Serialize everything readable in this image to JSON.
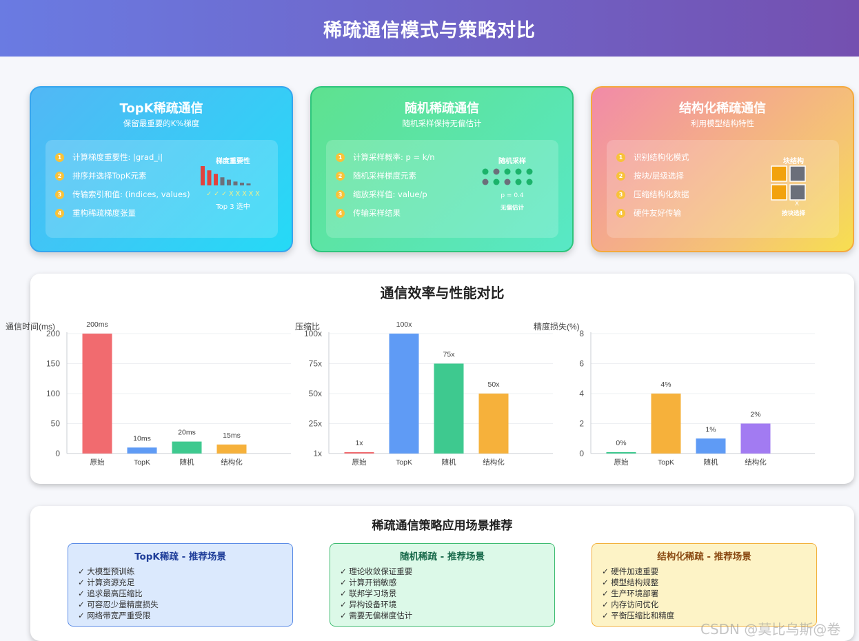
{
  "header": {
    "title": "稀疏通信模式与策略对比"
  },
  "cards": [
    {
      "title": "TopK稀疏通信",
      "subtitle": "保留最重要的K%梯度",
      "steps": [
        {
          "num": "1",
          "text": "计算梯度重要性: |grad_i|"
        },
        {
          "num": "2",
          "text": "排序并选择TopK元素"
        },
        {
          "num": "3",
          "text": "传输索引和值: (indices, values)"
        },
        {
          "num": "4",
          "text": "重构稀疏梯度张量"
        }
      ],
      "viz": {
        "title": "梯度重要性",
        "marks": "✓ ✓ ✓ X X X X X",
        "caption": "Top 3 选中",
        "bar_levels": [
          1.0,
          0.78,
          0.6,
          0.42,
          0.3,
          0.2,
          0.14,
          0.1
        ],
        "selected_color": "#e0423e",
        "other_color": "#6b6f7a"
      }
    },
    {
      "title": "随机稀疏通信",
      "subtitle": "随机采样保持无偏估计",
      "steps": [
        {
          "num": "1",
          "text": "计算采样概率: p = k/n"
        },
        {
          "num": "2",
          "text": "随机采样梯度元素"
        },
        {
          "num": "3",
          "text": "缩放采样值: value/p"
        },
        {
          "num": "4",
          "text": "传输采样结果"
        }
      ],
      "viz": {
        "title": "随机采样",
        "p_label": "p = 0.4",
        "caption": "无偏估计",
        "dot_sampled": [
          [
            true,
            false,
            true,
            true,
            true
          ],
          [
            false,
            true,
            false,
            true,
            true
          ]
        ],
        "sampled_color": "#1bb36a",
        "other_color": "#6b6f7a"
      }
    },
    {
      "title": "结构化稀疏通信",
      "subtitle": "利用模型结构特性",
      "steps": [
        {
          "num": "1",
          "text": "识别结构化模式"
        },
        {
          "num": "2",
          "text": "按块/层级选择"
        },
        {
          "num": "3",
          "text": "压缩结构化数据"
        },
        {
          "num": "4",
          "text": "硬件友好传输"
        }
      ],
      "viz": {
        "title": "块结构",
        "mark": "X",
        "caption": "按块选择",
        "block_colors": [
          "#f2a20d",
          "#6b6f7a",
          "#f2a20d",
          "#6b6f7a"
        ]
      }
    }
  ],
  "performance": {
    "title": "通信效率与性能对比"
  },
  "chart_data": [
    {
      "type": "bar",
      "ylabel": "通信时间(ms)",
      "categories": [
        "原始",
        "TopK",
        "随机",
        "结构化"
      ],
      "values": [
        200,
        10,
        20,
        15
      ],
      "data_labels": [
        "200ms",
        "10ms",
        "20ms",
        "15ms"
      ],
      "yticks": [
        "0",
        "50",
        "100",
        "150",
        "200"
      ],
      "ylim": [
        0,
        200
      ],
      "colors": [
        "#f16b6f",
        "#5f9bf5",
        "#3ec98f",
        "#f6b13b"
      ]
    },
    {
      "type": "bar",
      "ylabel": "压缩比",
      "categories": [
        "原始",
        "TopK",
        "随机",
        "结构化"
      ],
      "values": [
        1,
        100,
        75,
        50
      ],
      "data_labels": [
        "1x",
        "100x",
        "75x",
        "50x"
      ],
      "yticks": [
        "1x",
        "25x",
        "50x",
        "75x",
        "100x"
      ],
      "ylim": [
        0,
        100
      ],
      "colors": [
        "#f16b6f",
        "#5f9bf5",
        "#3ec98f",
        "#f6b13b"
      ]
    },
    {
      "type": "bar",
      "ylabel": "精度损失(%)",
      "categories": [
        "原始",
        "TopK",
        "随机",
        "结构化"
      ],
      "values": [
        0,
        4,
        1,
        2
      ],
      "data_labels": [
        "0%",
        "4%",
        "1%",
        "2%"
      ],
      "yticks": [
        "0",
        "2",
        "4",
        "6",
        "8"
      ],
      "ylim": [
        0,
        8
      ],
      "colors": [
        "#3ec98f",
        "#f6b13b",
        "#5f9bf5",
        "#a27bf2"
      ]
    }
  ],
  "recommend": {
    "title": "稀疏通信策略应用场景推荐",
    "boxes": [
      {
        "title": "TopK稀疏 - 推荐场景",
        "items": [
          "✓ 大模型预训练",
          "✓ 计算资源充足",
          "✓ 追求最高压缩比",
          "✓ 可容忍少量精度损失",
          "✓ 网络带宽严重受限"
        ]
      },
      {
        "title": "随机稀疏 - 推荐场景",
        "items": [
          "✓ 理论收敛保证重要",
          "✓ 计算开销敏感",
          "✓ 联邦学习场景",
          "✓ 异构设备环境",
          "✓ 需要无偏梯度估计"
        ]
      },
      {
        "title": "结构化稀疏 - 推荐场景",
        "items": [
          "✓ 硬件加速重要",
          "✓ 模型结构规整",
          "✓ 生产环境部署",
          "✓ 内存访问优化",
          "✓ 平衡压缩比和精度"
        ]
      }
    ]
  },
  "watermark": "CSDN @莫比乌斯@卷"
}
